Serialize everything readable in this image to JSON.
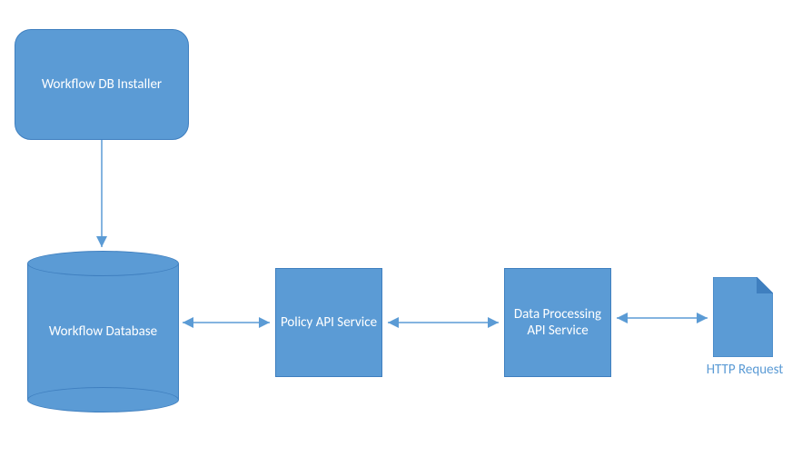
{
  "nodes": {
    "installer": {
      "label": "Workflow DB Installer"
    },
    "database": {
      "label": "Workflow Database"
    },
    "policy": {
      "label": "Policy API Service"
    },
    "dataproc": {
      "label": "Data Processing API Service"
    },
    "http": {
      "label": "HTTP Request"
    }
  },
  "colors": {
    "fill": "#5b9bd5",
    "stroke": "#3f7fbf",
    "link_text": "#5b9bd5"
  },
  "chart_data": {
    "type": "diagram",
    "title": "",
    "nodes": [
      {
        "id": "installer",
        "label": "Workflow DB Installer",
        "shape": "rounded-rect"
      },
      {
        "id": "database",
        "label": "Workflow Database",
        "shape": "cylinder"
      },
      {
        "id": "policy",
        "label": "Policy API Service",
        "shape": "rect"
      },
      {
        "id": "dataproc",
        "label": "Data Processing API Service",
        "shape": "rect"
      },
      {
        "id": "http",
        "label": "HTTP Request",
        "shape": "document"
      }
    ],
    "edges": [
      {
        "from": "installer",
        "to": "database",
        "direction": "one-way"
      },
      {
        "from": "database",
        "to": "policy",
        "direction": "two-way"
      },
      {
        "from": "policy",
        "to": "dataproc",
        "direction": "two-way"
      },
      {
        "from": "dataproc",
        "to": "http",
        "direction": "two-way"
      }
    ]
  }
}
